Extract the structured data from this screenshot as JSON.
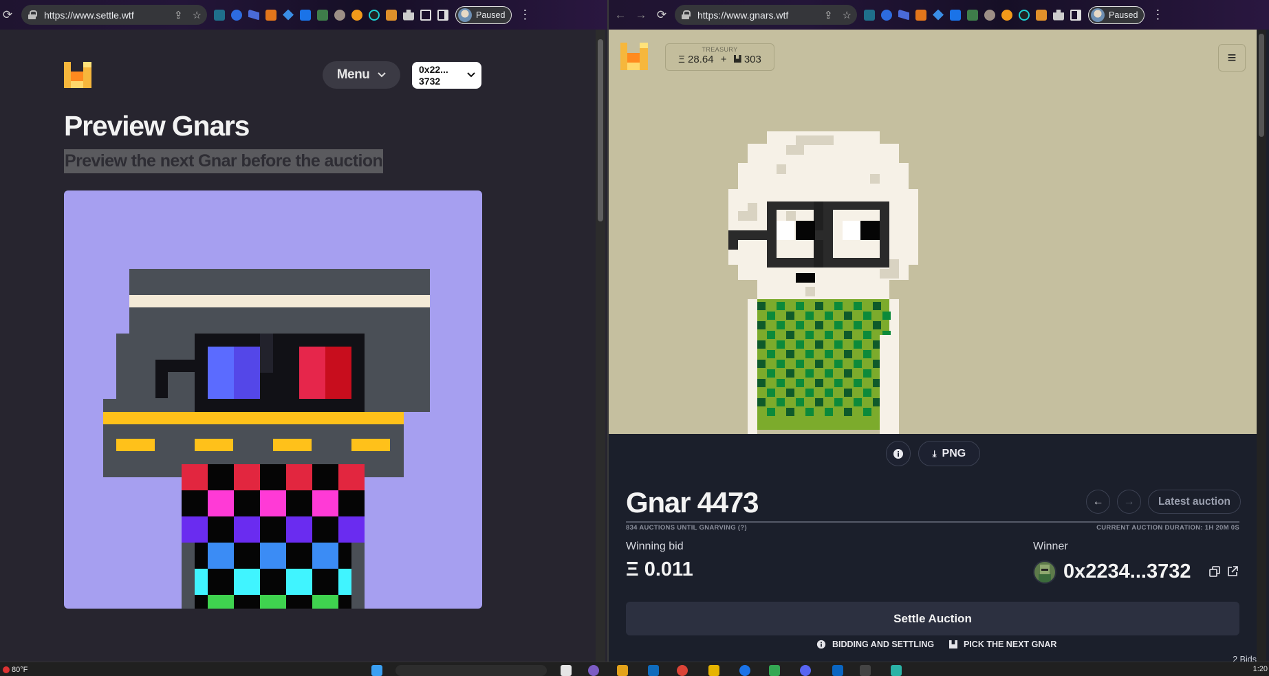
{
  "left_window": {
    "url": "https://www.settle.wtf",
    "profile_status": "Paused",
    "menu_label": "Menu",
    "wallet_line1": "0x22...",
    "wallet_line2": "3732",
    "title": "Preview Gnars",
    "subtitle": "Preview the next Gnar before the auction"
  },
  "right_window": {
    "url": "https://www.gnars.wtf",
    "profile_status": "Paused",
    "treasury": {
      "label": "TREASURY",
      "eth": "Ξ 28.64",
      "plus": "+",
      "gnars_count": "303"
    },
    "info_label": "i",
    "png_label": "PNG",
    "auction_title": "Gnar 4473",
    "auctions_until": "834 AUCTIONS UNTIL GNARVING (?)",
    "duration": "CURRENT AUCTION DURATION: 1H 20M 0S",
    "latest_auction": "Latest auction",
    "winning_bid_label": "Winning bid",
    "winning_bid_value": "Ξ 0.011",
    "winner_label": "Winner",
    "winner_value": "0x2234...3732",
    "settle_label": "Settle Auction",
    "bidding_link": "BIDDING AND SETTLING",
    "pick_link": "PICK THE NEXT GNAR",
    "bids_count": "2 Bids"
  },
  "taskbar": {
    "temperature": "80°F",
    "time": "1:20"
  },
  "colors": {
    "left_bg": "#27252f",
    "preview_bg": "#a69ff0",
    "right_art_bg": "#c5bf9f",
    "right_panel_bg": "#1b1f2b"
  }
}
